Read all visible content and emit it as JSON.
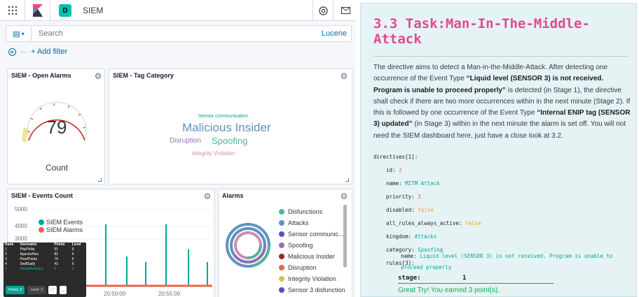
{
  "topbar": {
    "space_letter": "D",
    "app_title": "SIEM"
  },
  "query": {
    "search_placeholder": "Search",
    "language": "Lucene",
    "add_filter": "+ Add filter"
  },
  "panels": {
    "open_alarms": {
      "title": "SIEM - Open Alarms",
      "value": "79",
      "label": "Count"
    },
    "tag_category": {
      "title": "SIEM - Tag Category",
      "tags": [
        "Sensor communication",
        "Malicious Insider",
        "Disruption",
        "Spoofing",
        "Integrity Violation"
      ]
    },
    "events_count": {
      "title": "SIEM - Events Count",
      "y_ticks": [
        "5000",
        "4000",
        "3000"
      ],
      "x_ticks": [
        "20:50:00",
        "20:55:00"
      ],
      "legend": [
        "SIEM Events",
        "SIEM Alarms"
      ]
    },
    "alarms": {
      "title": "Alarms",
      "legend": [
        "Disfunctions",
        "Attacks",
        "Sensor communic...",
        "Spoofing",
        "Malicious Insider",
        "Disruption",
        "Integrity Violation",
        "Sensor 3 disfunction"
      ]
    }
  },
  "leaderboard": {
    "headers": [
      "Rank",
      "Username",
      "Points",
      "Level"
    ],
    "rows": [
      [
        "1",
        "PhpPhilip",
        "91",
        "6"
      ],
      [
        "2",
        "ApacheAlex",
        "82",
        "6"
      ],
      [
        "3",
        "PearlPaula",
        "76",
        "6"
      ],
      [
        "4",
        "SwiftSally",
        "43",
        "6"
      ],
      [
        "5",
        "VisualVeronica",
        "9",
        "2"
      ]
    ],
    "points_btn": "Points: 9",
    "level_btn": "Level: 2"
  },
  "task": {
    "title": "3.3 Task:Man-In-The-Middle-Attack",
    "desc": {
      "p1": "The directive aims to detect a Man-in-the-Middle-Attack. After detecting one occurrence of the Event Type ",
      "b1": "“Liquid level (SENSOR 3) is not received. Program is unable to proceed properly”",
      "p2": " is detected (in Stage 1), the directive shall check if there are two more occurrences within in the next minute (Stage 2). If this is followed by one occurrence of the Event Type ",
      "b2": "“Internal ENIP tag (SENSOR 3) updated”",
      "p3": " (in Stage 3) within in the next minute the alarm is set off. You will not need the SIEM dashboard here, just have a close look at 3.2."
    },
    "code": {
      "directives": "directives[1]:",
      "id_k": "id:",
      "id_v": "2",
      "name_k": "name:",
      "name_v": "MITM Attack",
      "priority_k": "priority:",
      "priority_v": "3",
      "disabled_k": "disabled:",
      "disabled_v": "false",
      "all_rules_k": "all_rules_always_active:",
      "all_rules_v": "false",
      "kingdom_k": "kingdom:",
      "kingdom_v": "Attacks",
      "category_k": "category:",
      "category_v": "Spoofing",
      "rules": "rules[3]:",
      "rule_name_k": "name:",
      "rule_name_v1": "Liquid level (SENSOR 3) is not received. Program is unable to",
      "rule_name_v2": "proceed properly"
    },
    "stage_label": "stage:",
    "stage_value": "1",
    "feedback": "Great Try! You earned 3 point(s)."
  },
  "colors": {
    "teal": "#00a69b",
    "red": "#e7664c",
    "pink": "#e24990",
    "green": "#00b34a",
    "kibana_blue": "#006bb4"
  }
}
